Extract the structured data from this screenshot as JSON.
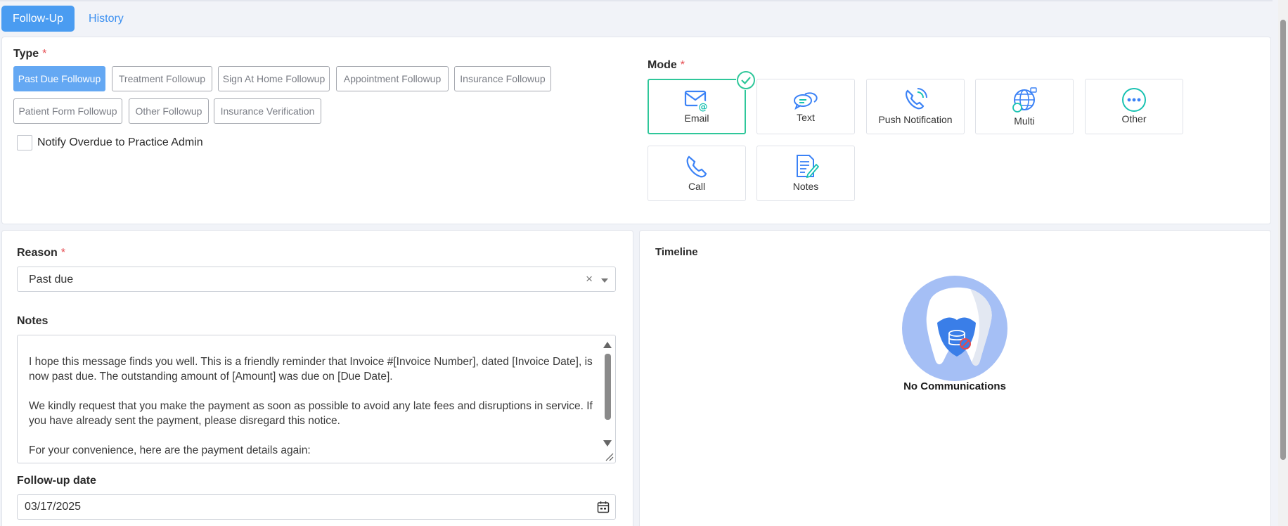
{
  "tabs": [
    {
      "label": "Follow-Up",
      "active": true
    },
    {
      "label": "History",
      "active": false
    }
  ],
  "type_section": {
    "label": "Type",
    "required": "*",
    "chips": [
      {
        "label": "Past Due Followup",
        "selected": true
      },
      {
        "label": "Treatment Followup",
        "selected": false
      },
      {
        "label": "Sign At Home Followup",
        "selected": false
      },
      {
        "label": "Appointment Followup",
        "selected": false
      },
      {
        "label": "Insurance Followup",
        "selected": false
      },
      {
        "label": "Patient Form Followup",
        "selected": false
      },
      {
        "label": "Other Followup",
        "selected": false
      },
      {
        "label": "Insurance Verification",
        "selected": false
      }
    ],
    "notify_label": "Notify Overdue to Practice Admin"
  },
  "mode_section": {
    "label": "Mode",
    "required": "*",
    "modes": [
      {
        "label": "Email",
        "icon": "email-icon",
        "selected": true
      },
      {
        "label": "Text",
        "icon": "chat-bubbles-icon",
        "selected": false
      },
      {
        "label": "Push Notification",
        "icon": "phone-ringing-icon",
        "selected": false
      },
      {
        "label": "Multi",
        "icon": "globe-multi-icon",
        "selected": false
      },
      {
        "label": "Other",
        "icon": "more-dots-icon",
        "selected": false
      },
      {
        "label": "Call",
        "icon": "phone-icon",
        "selected": false
      },
      {
        "label": "Notes",
        "icon": "notes-icon",
        "selected": false
      }
    ]
  },
  "reason": {
    "label": "Reason",
    "required": "*",
    "value": "Past due",
    "clear": "×"
  },
  "notes": {
    "label": "Notes",
    "text": "I hope this message finds you well. This is a friendly reminder that Invoice #[Invoice Number], dated [Invoice Date], is now past due. The outstanding amount of [Amount] was due on [Due Date].\n\nWe kindly request that you make the payment as soon as possible to avoid any late fees and disruptions in service. If you have already sent the payment, please disregard this notice.\n\nFor your convenience, here are the payment details again:"
  },
  "followup_date": {
    "label": "Follow-up date",
    "value": "03/17/2025"
  },
  "timeline": {
    "label": "Timeline",
    "empty_text": "No Communications"
  },
  "colors": {
    "accent": "#4a9cf1",
    "selected_chip": "#64a8f3",
    "mode_selected_border": "#2fc79a",
    "required": "#e5484d",
    "icon_blue": "#3b82f6",
    "icon_teal": "#19c2b2"
  }
}
